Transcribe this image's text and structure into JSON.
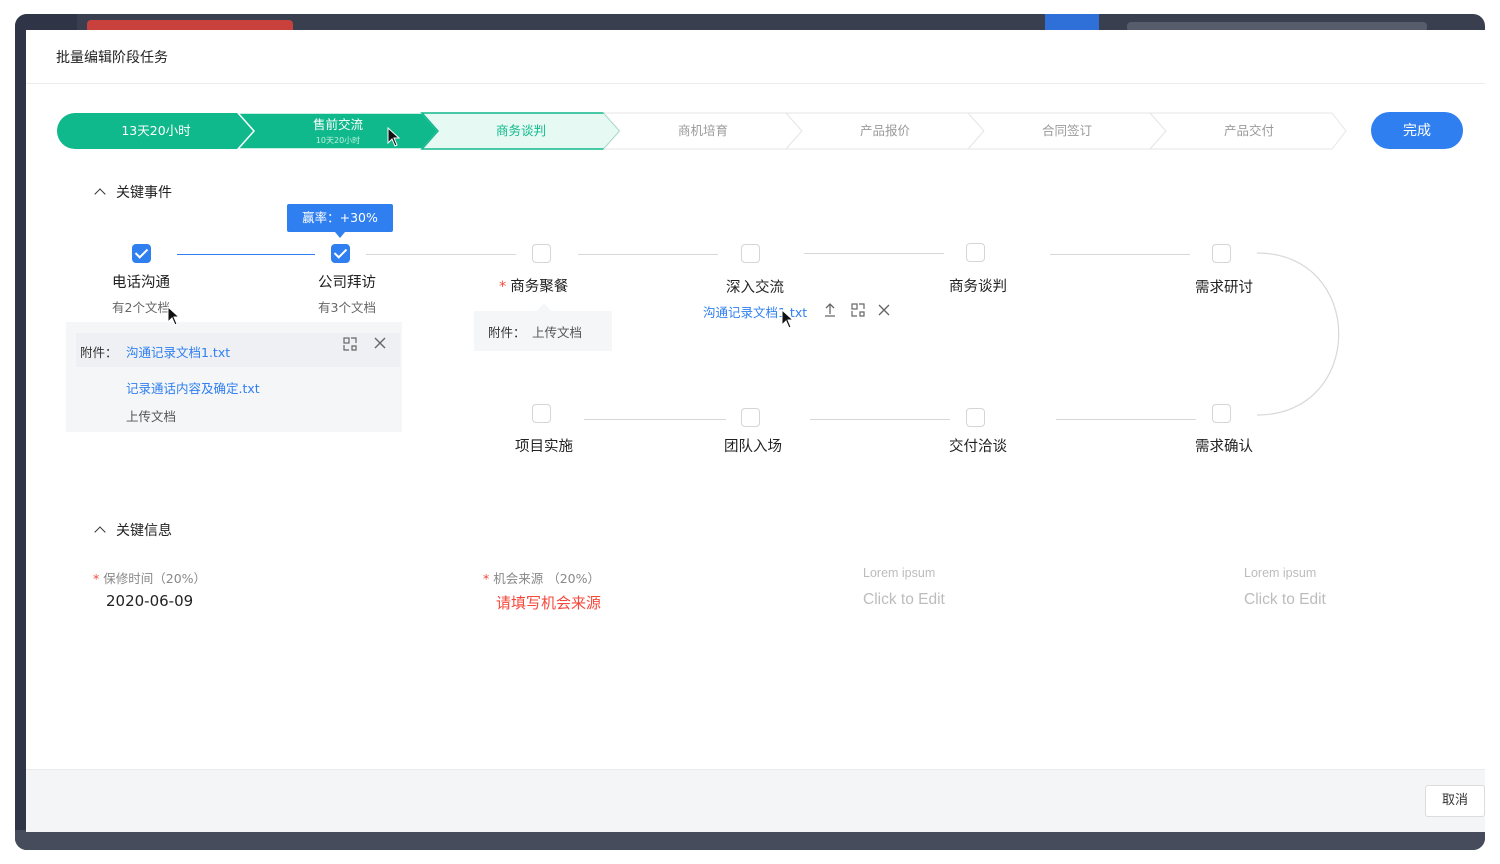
{
  "modal": {
    "title": "批量编辑阶段任务",
    "finish_label": "完成",
    "cancel_label": "取消"
  },
  "stages": [
    {
      "label": "13天20小时",
      "state": "done"
    },
    {
      "label": "售前交流",
      "sub": "10天20小时",
      "state": "done"
    },
    {
      "label": "商务谈判",
      "state": "current"
    },
    {
      "label": "商机培育",
      "state": "todo"
    },
    {
      "label": "产品报价",
      "state": "todo"
    },
    {
      "label": "合同签订",
      "state": "todo"
    },
    {
      "label": "产品交付",
      "state": "todo"
    }
  ],
  "key_events": {
    "title": "关键事件",
    "tooltip": "赢率：+30%",
    "events": [
      {
        "name": "电话沟通",
        "sub": "有2个文档",
        "checked": true
      },
      {
        "name": "公司拜访",
        "sub": "有3个文档",
        "checked": true
      },
      {
        "name": "商务聚餐",
        "required": true,
        "checked": false
      },
      {
        "name": "深入交流",
        "checked": false
      },
      {
        "name": "商务谈判",
        "checked": false
      },
      {
        "name": "需求研讨",
        "checked": false
      },
      {
        "name": "项目实施",
        "checked": false
      },
      {
        "name": "团队入场",
        "checked": false
      },
      {
        "name": "交付洽谈",
        "checked": false
      },
      {
        "name": "需求确认",
        "checked": false
      }
    ],
    "attachment_label": "附件：",
    "attachments_call": [
      "沟通记录文档1.txt",
      "记录通话内容及确定.txt"
    ],
    "upload_label": "上传文档",
    "deep_attachment": "沟通记录文档1.txt"
  },
  "key_info": {
    "title": "关键信息",
    "fields": [
      {
        "label": "保修时间（20%）",
        "value": "2020-06-09",
        "required": true
      },
      {
        "label": "机会来源 （20%）",
        "value": "请填写机会来源",
        "required": true,
        "error": true
      },
      {
        "label": "Lorem ipsum",
        "value": "Click to Edit"
      },
      {
        "label": "Lorem ipsum",
        "value": "Click to Edit"
      }
    ]
  },
  "colors": {
    "done": "#10b98c",
    "current_bg": "#e6faf3",
    "primary": "#2f7ff0",
    "error": "#f5483b"
  }
}
